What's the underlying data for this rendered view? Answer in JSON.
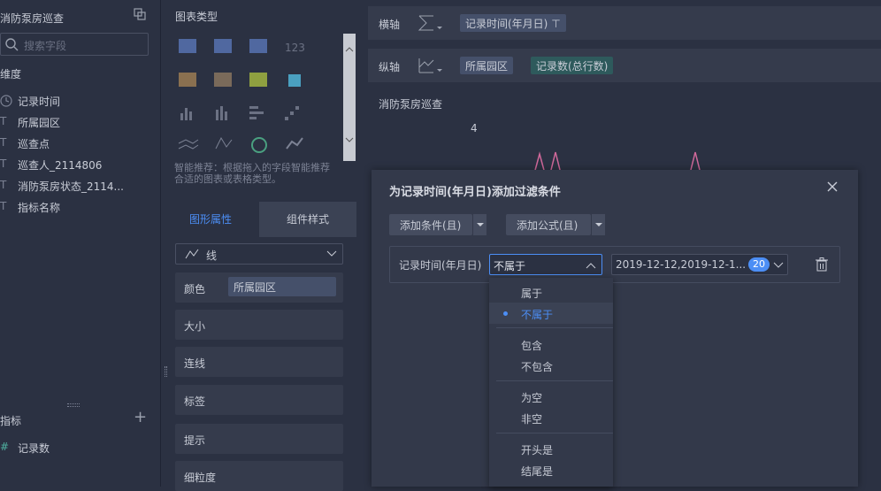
{
  "left": {
    "title": "消防泵房巡查",
    "search_placeholder": "搜索字段",
    "dimension_label": "维度",
    "dimensions": [
      {
        "icon": "clock-icon",
        "label": "记录时间"
      },
      {
        "icon": "text-type-icon",
        "label": "所属园区"
      },
      {
        "icon": "text-type-icon",
        "label": "巡查点"
      },
      {
        "icon": "text-type-icon",
        "label": "巡查人_2114806"
      },
      {
        "icon": "text-type-icon",
        "label": "消防泵房状态_2114..."
      },
      {
        "icon": "text-type-icon",
        "label": "指标名称"
      }
    ],
    "measure_label": "指标",
    "add_label": "+",
    "measures": [
      {
        "icon": "hash-icon",
        "label": "记录数"
      }
    ]
  },
  "mid": {
    "chart_type_label": "图表类型",
    "smart_tip": "智能推荐：根据拖入的字段智能推荐合适的图表或表格类型。",
    "tabs": [
      "图形属性",
      "组件样式"
    ],
    "line_type": "线",
    "color_label": "颜色",
    "color_value": "所属园区",
    "props": [
      "大小",
      "连线",
      "标签",
      "提示",
      "细粒度"
    ]
  },
  "main": {
    "x_axis_label": "横轴",
    "x_axis_pill": "记录时间(年月日)",
    "y_axis_label": "纵轴",
    "y_axis_pills": [
      "所属园区",
      "记录数(总行数)"
    ],
    "chart_title": "消防泵房巡查",
    "y_tick": "4"
  },
  "dialog": {
    "title": "为记录时间(年月日)添加过滤条件",
    "add_condition": "添加条件(且)",
    "add_formula": "添加公式(且)",
    "condition_field": "记录时间(年月日)",
    "operator": "不属于",
    "value": "2019-12-12,2019-12-1...",
    "value_count": "20",
    "options": [
      {
        "label": "属于",
        "selected": false
      },
      {
        "label": "不属于",
        "selected": true
      },
      {
        "label": "包含",
        "selected": false
      },
      {
        "label": "不包含",
        "selected": false
      },
      {
        "label": "为空",
        "selected": false
      },
      {
        "label": "非空",
        "selected": false
      },
      {
        "label": "开头是",
        "selected": false
      },
      {
        "label": "结尾是",
        "selected": false
      }
    ]
  },
  "colors": {
    "accent": "#4c8ef5",
    "line": "#d0689a",
    "panel": "#2b3142"
  }
}
